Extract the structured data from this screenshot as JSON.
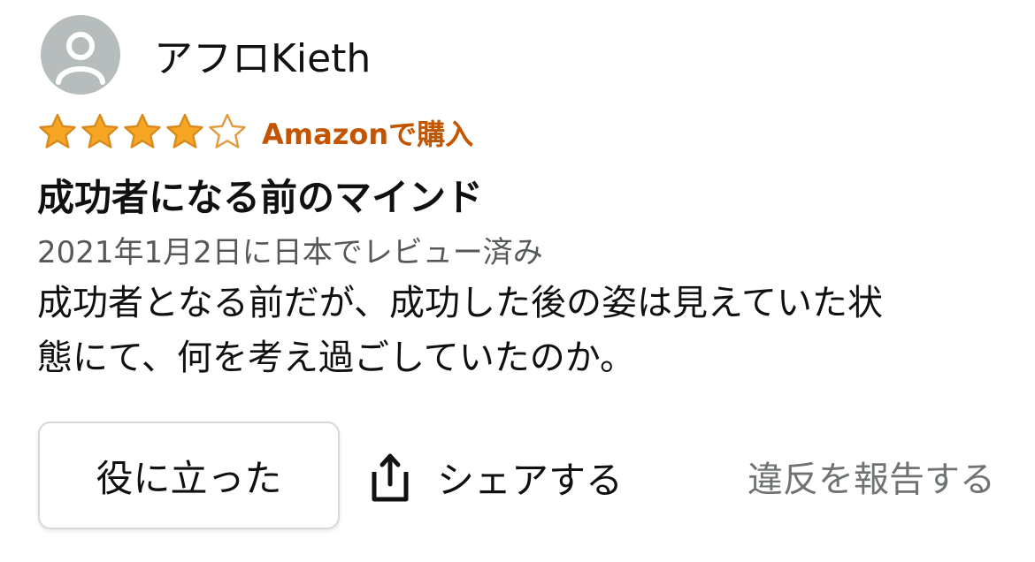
{
  "review": {
    "reviewer": {
      "name": "アフロKieth",
      "avatar_icon": "person-icon",
      "avatar_color": "#b7bcbd"
    },
    "rating": {
      "value": 4,
      "max": 5,
      "filled_color": "#f5a623",
      "empty_color": "#e29a3a"
    },
    "verified_label": "Amazonで購入",
    "title": "成功者になる前のマインド",
    "date": "2021年1月2日に日本でレビュー済み",
    "body_lines": [
      "成功者となる前だが、成功した後の姿は見えていた状",
      "態にて、何を考え過ごしていたのか。"
    ],
    "actions": {
      "helpful_label": "役に立った",
      "share_label": "シェアする",
      "share_icon": "share-icon",
      "report_label": "違反を報告する"
    },
    "colors": {
      "verified": "#c45500",
      "secondary_text": "#565959",
      "link_gray": "#6f7373"
    }
  }
}
